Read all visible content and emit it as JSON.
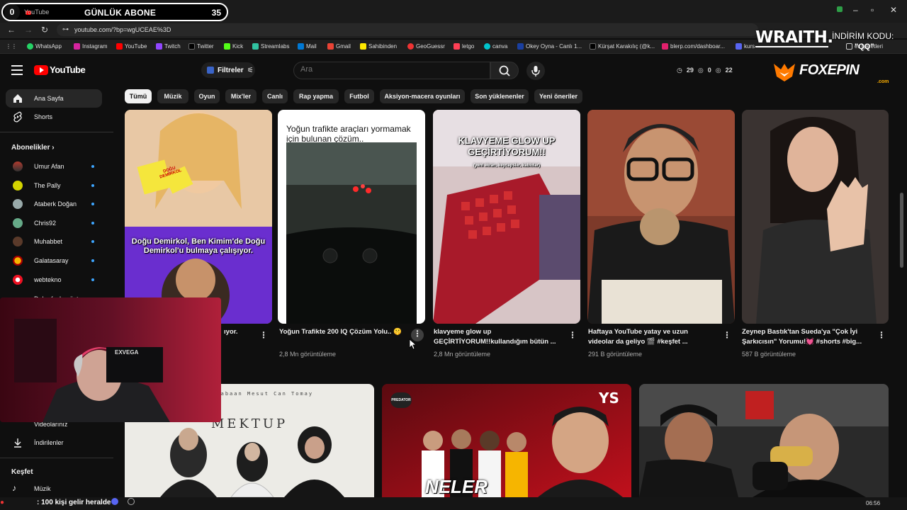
{
  "browser": {
    "tab_label": "YouTube",
    "url": "youtube.com/?bp=wgUCEAE%3D",
    "bookmarks": [
      "WhatsApp",
      "Instagram",
      "YouTube",
      "Twitch",
      "Twitter",
      "Kick",
      "Streamlabs",
      "Mail",
      "Gmail",
      "Sahibinden",
      "GeoGuessr",
      "letgo",
      "canva",
      "Okey Oyna - Canlı 1...",
      "Kürşat Karakılıç (@k...",
      "blerp.com/dashboar...",
      "kurs",
      "er İşaretleri"
    ]
  },
  "stream_overlay": {
    "abone_left": "0",
    "abone_title": "GÜNLÜK ABONE",
    "abone_right": "35",
    "sponsor_wraith": "WRAITH.",
    "indirim_label": "İNDİRİM KODU:",
    "indirim_code": "\"QQ\"",
    "sponsor_foxepin": "FOXEPIN",
    "sponsor_foxepin_com": ".com",
    "webcam_tag": "EXVEGA",
    "bottom_message": ": 100 kişi gelir heralde"
  },
  "youtube": {
    "logo_text": "YouTube",
    "filters_label": "Filtreler",
    "search_placeholder": "Ara",
    "stats": {
      "a": "29",
      "b": "0",
      "c": "22"
    },
    "chips": [
      "Tümü",
      "Müzik",
      "Oyun",
      "Mix'ler",
      "Canlı",
      "Rap yapma",
      "Futbol",
      "Aksiyon-macera oyunları",
      "Son yüklenenler",
      "Yeni öneriler"
    ],
    "sidebar": {
      "home": "Ana Sayfa",
      "shorts": "Shorts",
      "subscriptions_heading": "Abonelikler",
      "channels": [
        "Umur Afan",
        "The Pally",
        "Ataberk Doğan",
        "Chris92",
        "Muhabbet",
        "Galatasaray",
        "webtekno"
      ],
      "show_more": "Daha fazla göster",
      "videos": "Videolarınız",
      "downloads": "İndirilenler",
      "explore_heading": "Keşfet",
      "music": "Müzik"
    },
    "shorts": [
      {
        "overlay": "Doğu Demirkol, Ben Kimim'de Doğu Demirkol'u bulmaya çalışıyor.",
        "sticker": "DOĞU DEMİRKOL",
        "title": "ıyor.",
        "views": ""
      },
      {
        "overlay": "Yoğun trafikte araçları yormamak için bulunan çözüm..",
        "title": "Yoğun Trafikte 200 IQ Çözüm Yolu.. 🤫",
        "views": "2,8 Mn görüntüleme"
      },
      {
        "overlay": "KLAVYEME GLOW UP GEÇİRTİYORUM!!",
        "overlay_sub": "(yeni ekran, keycapsler, kablolar)",
        "title": "klavyeme glow up GEÇİRTİYORUM!!kullandığım bütün ...",
        "views": "2,8 Mn görüntüleme"
      },
      {
        "title": "Haftaya YouTube yatay ve uzun videolar da geliyo 🎬 #keşfet ...",
        "views": "291 B görüntüleme"
      },
      {
        "title": "Zeynep Bastık'tan Sueda'ya \"Çok İyi Şarkıcısın\" Yorumu!💓 #shorts #big...",
        "views": "587 B görüntüleme"
      }
    ],
    "videos": [
      {
        "thumb_text": "MEKTUP",
        "thumb_top": "Lohide Şabaan   Mesut Can Tomay"
      },
      {
        "thumb_text": "NELER OLUYOR?",
        "badge": "YS",
        "brand": "PREDATOR"
      },
      {
        "thumb_text": ""
      }
    ]
  },
  "taskbar": {
    "time": "06:56"
  }
}
